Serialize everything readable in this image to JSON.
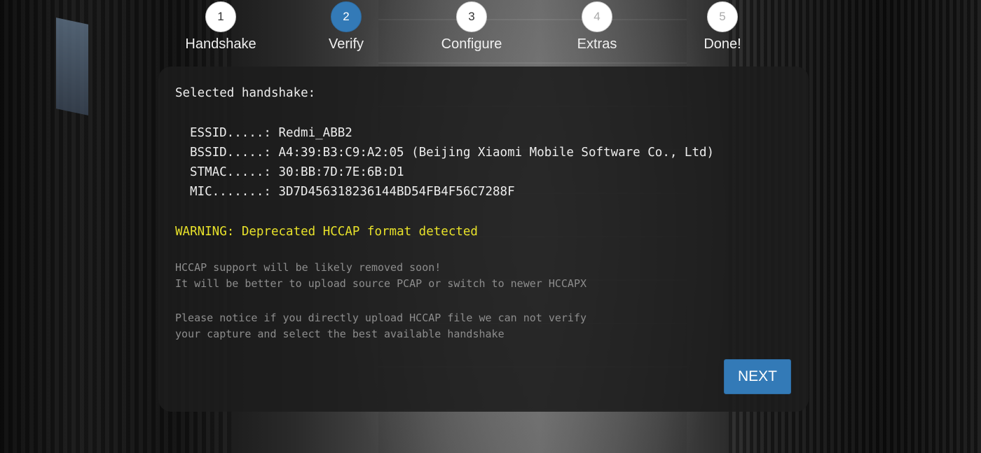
{
  "wizard": {
    "steps": [
      {
        "number": "1",
        "label": "Handshake",
        "state": "done"
      },
      {
        "number": "2",
        "label": "Verify",
        "state": "active"
      },
      {
        "number": "3",
        "label": "Configure",
        "state": "pending"
      },
      {
        "number": "4",
        "label": "Extras",
        "state": "disabled"
      },
      {
        "number": "5",
        "label": "Done!",
        "state": "disabled"
      }
    ]
  },
  "handshake": {
    "heading": "Selected handshake:",
    "fields": [
      {
        "key": "ESSID.....:",
        "value": "Redmi_ABB2"
      },
      {
        "key": "BSSID.....:",
        "value": "A4:39:B3:C9:A2:05 (Beijing Xiaomi Mobile Software Co., Ltd)"
      },
      {
        "key": "STMAC.....:",
        "value": "30:BB:7D:7E:6B:D1"
      },
      {
        "key": "MIC.......:",
        "value": "3D7D456318236144BD54FB4F56C7288F"
      }
    ],
    "warning": "WARNING: Deprecated HCCAP format detected",
    "notes": [
      [
        "HCCAP support will be likely removed soon!",
        "It will be better to upload source PCAP or switch to newer HCCAPX"
      ],
      [
        "Please notice if you directly upload HCCAP file we can not verify",
        "your capture and select the best available handshake"
      ]
    ]
  },
  "actions": {
    "next_label": "NEXT"
  },
  "colors": {
    "accent": "#337ab7",
    "warning": "#e8e22a",
    "muted_text": "#8d8d8d"
  }
}
